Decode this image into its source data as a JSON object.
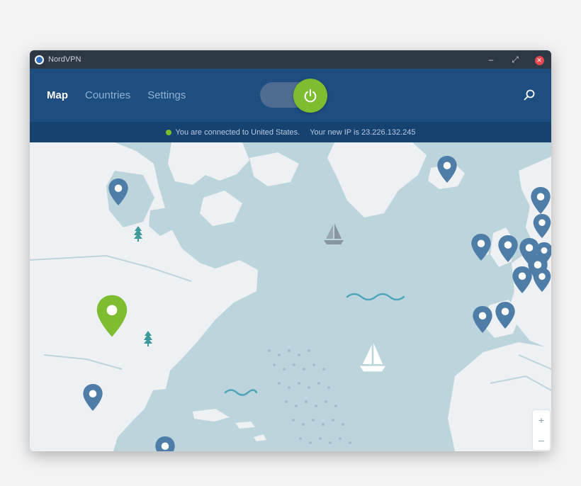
{
  "window": {
    "title": "NordVPN",
    "controls": {
      "minimize": "–",
      "maximize": "⤢",
      "close": "✕"
    }
  },
  "nav": {
    "items": [
      {
        "label": "Map",
        "active": true
      },
      {
        "label": "Countries",
        "active": false
      },
      {
        "label": "Settings",
        "active": false
      }
    ]
  },
  "connection": {
    "connected": true,
    "status_text": "You are connected to United States.",
    "ip_text": "Your new IP is 23.226.132.245"
  },
  "icons": {
    "power": "power-icon",
    "search": "search-icon",
    "location_pin": "location-pin-icon",
    "tree": "tree-icon",
    "sailboat": "sailboat-icon",
    "waves": "waves-icon"
  },
  "colors": {
    "header": "#1e4d7f",
    "status_bar": "#16426f",
    "accent_green": "#7dbd2f",
    "pin_blue": "#4e7ea7",
    "ocean": "#bcd4dc",
    "land": "#eef1f3"
  },
  "map": {
    "zoom_in": "+",
    "zoom_out": "–"
  }
}
